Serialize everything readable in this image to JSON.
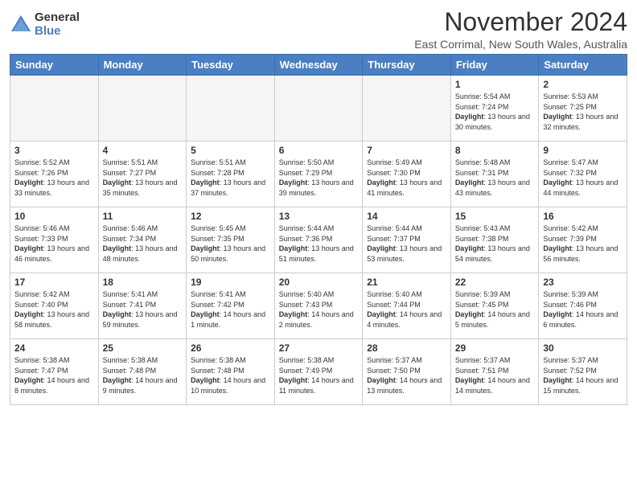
{
  "logo": {
    "general": "General",
    "blue": "Blue"
  },
  "title": "November 2024",
  "location": "East Corrimal, New South Wales, Australia",
  "days_of_week": [
    "Sunday",
    "Monday",
    "Tuesday",
    "Wednesday",
    "Thursday",
    "Friday",
    "Saturday"
  ],
  "weeks": [
    [
      {
        "day": "",
        "info": ""
      },
      {
        "day": "",
        "info": ""
      },
      {
        "day": "",
        "info": ""
      },
      {
        "day": "",
        "info": ""
      },
      {
        "day": "",
        "info": ""
      },
      {
        "day": "1",
        "info": "Sunrise: 5:54 AM\nSunset: 7:24 PM\nDaylight: 13 hours and 30 minutes."
      },
      {
        "day": "2",
        "info": "Sunrise: 5:53 AM\nSunset: 7:25 PM\nDaylight: 13 hours and 32 minutes."
      }
    ],
    [
      {
        "day": "3",
        "info": "Sunrise: 5:52 AM\nSunset: 7:26 PM\nDaylight: 13 hours and 33 minutes."
      },
      {
        "day": "4",
        "info": "Sunrise: 5:51 AM\nSunset: 7:27 PM\nDaylight: 13 hours and 35 minutes."
      },
      {
        "day": "5",
        "info": "Sunrise: 5:51 AM\nSunset: 7:28 PM\nDaylight: 13 hours and 37 minutes."
      },
      {
        "day": "6",
        "info": "Sunrise: 5:50 AM\nSunset: 7:29 PM\nDaylight: 13 hours and 39 minutes."
      },
      {
        "day": "7",
        "info": "Sunrise: 5:49 AM\nSunset: 7:30 PM\nDaylight: 13 hours and 41 minutes."
      },
      {
        "day": "8",
        "info": "Sunrise: 5:48 AM\nSunset: 7:31 PM\nDaylight: 13 hours and 43 minutes."
      },
      {
        "day": "9",
        "info": "Sunrise: 5:47 AM\nSunset: 7:32 PM\nDaylight: 13 hours and 44 minutes."
      }
    ],
    [
      {
        "day": "10",
        "info": "Sunrise: 5:46 AM\nSunset: 7:33 PM\nDaylight: 13 hours and 46 minutes."
      },
      {
        "day": "11",
        "info": "Sunrise: 5:46 AM\nSunset: 7:34 PM\nDaylight: 13 hours and 48 minutes."
      },
      {
        "day": "12",
        "info": "Sunrise: 5:45 AM\nSunset: 7:35 PM\nDaylight: 13 hours and 50 minutes."
      },
      {
        "day": "13",
        "info": "Sunrise: 5:44 AM\nSunset: 7:36 PM\nDaylight: 13 hours and 51 minutes."
      },
      {
        "day": "14",
        "info": "Sunrise: 5:44 AM\nSunset: 7:37 PM\nDaylight: 13 hours and 53 minutes."
      },
      {
        "day": "15",
        "info": "Sunrise: 5:43 AM\nSunset: 7:38 PM\nDaylight: 13 hours and 54 minutes."
      },
      {
        "day": "16",
        "info": "Sunrise: 5:42 AM\nSunset: 7:39 PM\nDaylight: 13 hours and 56 minutes."
      }
    ],
    [
      {
        "day": "17",
        "info": "Sunrise: 5:42 AM\nSunset: 7:40 PM\nDaylight: 13 hours and 58 minutes."
      },
      {
        "day": "18",
        "info": "Sunrise: 5:41 AM\nSunset: 7:41 PM\nDaylight: 13 hours and 59 minutes."
      },
      {
        "day": "19",
        "info": "Sunrise: 5:41 AM\nSunset: 7:42 PM\nDaylight: 14 hours and 1 minute."
      },
      {
        "day": "20",
        "info": "Sunrise: 5:40 AM\nSunset: 7:43 PM\nDaylight: 14 hours and 2 minutes."
      },
      {
        "day": "21",
        "info": "Sunrise: 5:40 AM\nSunset: 7:44 PM\nDaylight: 14 hours and 4 minutes."
      },
      {
        "day": "22",
        "info": "Sunrise: 5:39 AM\nSunset: 7:45 PM\nDaylight: 14 hours and 5 minutes."
      },
      {
        "day": "23",
        "info": "Sunrise: 5:39 AM\nSunset: 7:46 PM\nDaylight: 14 hours and 6 minutes."
      }
    ],
    [
      {
        "day": "24",
        "info": "Sunrise: 5:38 AM\nSunset: 7:47 PM\nDaylight: 14 hours and 8 minutes."
      },
      {
        "day": "25",
        "info": "Sunrise: 5:38 AM\nSunset: 7:48 PM\nDaylight: 14 hours and 9 minutes."
      },
      {
        "day": "26",
        "info": "Sunrise: 5:38 AM\nSunset: 7:48 PM\nDaylight: 14 hours and 10 minutes."
      },
      {
        "day": "27",
        "info": "Sunrise: 5:38 AM\nSunset: 7:49 PM\nDaylight: 14 hours and 11 minutes."
      },
      {
        "day": "28",
        "info": "Sunrise: 5:37 AM\nSunset: 7:50 PM\nDaylight: 14 hours and 13 minutes."
      },
      {
        "day": "29",
        "info": "Sunrise: 5:37 AM\nSunset: 7:51 PM\nDaylight: 14 hours and 14 minutes."
      },
      {
        "day": "30",
        "info": "Sunrise: 5:37 AM\nSunset: 7:52 PM\nDaylight: 14 hours and 15 minutes."
      }
    ]
  ]
}
